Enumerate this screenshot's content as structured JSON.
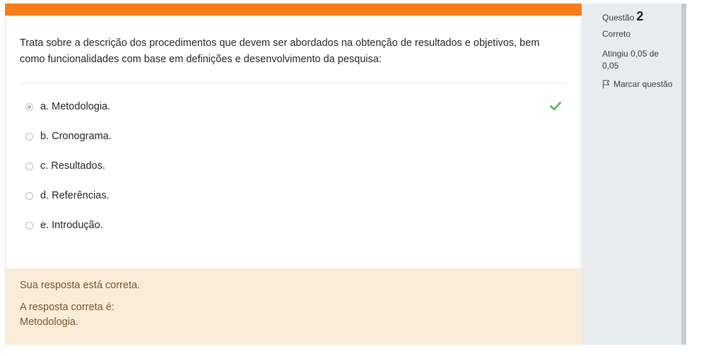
{
  "question": {
    "text": "Trata sobre a descrição dos procedimentos que devem ser abordados na obtenção de resultados e objetivos, bem como funcionalidades com base em definições e desenvolvimento da pesquisa:",
    "answers": [
      {
        "label": "a. Metodologia.",
        "selected": true,
        "correct": true
      },
      {
        "label": "b. Cronograma.",
        "selected": false
      },
      {
        "label": "c. Resultados.",
        "selected": false
      },
      {
        "label": "d. Referências.",
        "selected": false
      },
      {
        "label": "e. Introdução.",
        "selected": false
      }
    ]
  },
  "feedback": {
    "status": "Sua resposta está correta.",
    "correct_intro": "A resposta correta é:",
    "correct_answer": "Metodologia."
  },
  "info": {
    "question_label": "Questão",
    "question_number": "2",
    "state": "Correto",
    "grade": "Atingiu 0,05 de 0,05",
    "flag_label": "Marcar questão"
  },
  "colors": {
    "accent": "#f97b1b",
    "feedback_bg": "#fbebd9",
    "feedback_text": "#7a5a2f",
    "check": "#5cb85c",
    "info_bg": "#e9ecef"
  },
  "icons": {
    "correct": "check-icon",
    "flag": "flag-icon"
  }
}
